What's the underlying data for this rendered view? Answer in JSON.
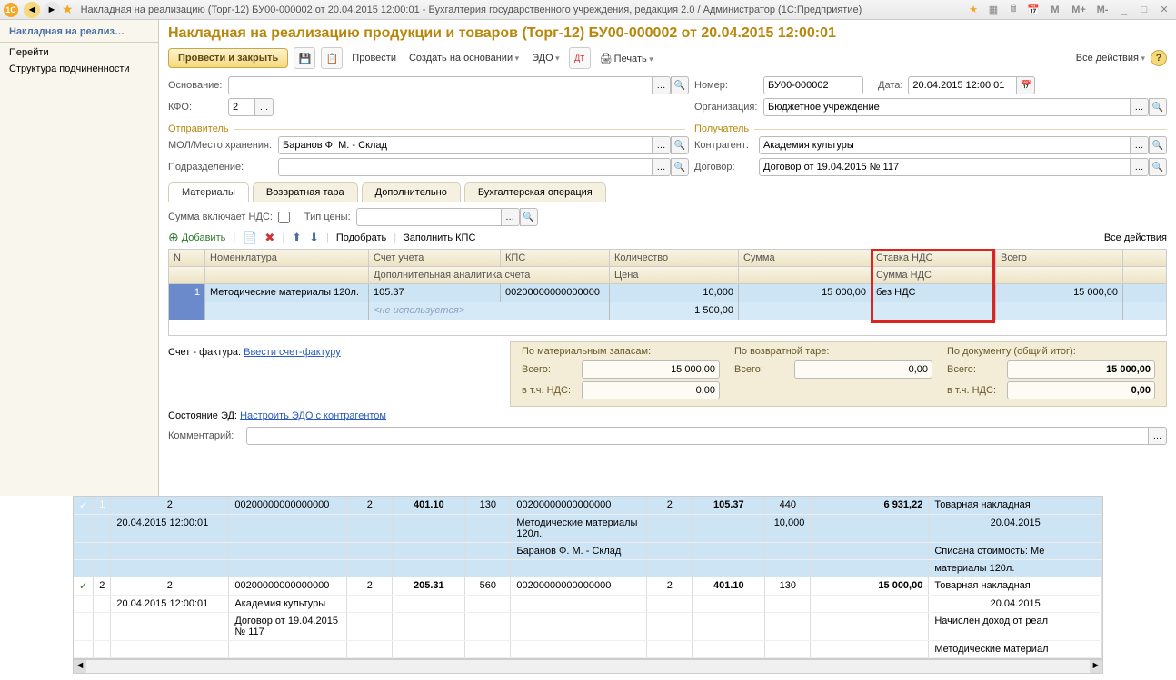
{
  "titlebar": {
    "text": "Накладная на реализацию (Торг-12) БУ00-000002 от 20.04.2015 12:00:01 - Бухгалтерия государственного учреждения, редакция 2.0 / Администратор  (1С:Предприятие)",
    "m": "M",
    "m_plus": "M+",
    "m_minus": "M-"
  },
  "sidebar": {
    "items": [
      "Накладная на реализ…",
      "Перейти",
      "Структура подчиненности"
    ]
  },
  "doc_title": "Накладная на реализацию продукции и товаров (Торг-12) БУ00-000002 от 20.04.2015 12:00:01",
  "toolbar": {
    "post_close": "Провести и закрыть",
    "post": "Провести",
    "create_on": "Создать на основании",
    "edo": "ЭДО",
    "print": "Печать",
    "all_actions": "Все действия"
  },
  "form": {
    "osnovanie_label": "Основание:",
    "osnovanie_value": "",
    "nomer_label": "Номер:",
    "nomer_value": "БУ00-000002",
    "data_label": "Дата:",
    "data_value": "20.04.2015 12:00:01",
    "kfo_label": "КФО:",
    "kfo_value": "2",
    "org_label": "Организация:",
    "org_value": "Бюджетное учреждение",
    "sender_label": "Отправитель",
    "receiver_label": "Получатель",
    "mol_label": "МОЛ/Место хранения:",
    "mol_value": "Баранов Ф. М. - Склад",
    "kontr_label": "Контрагент:",
    "kontr_value": "Академия культуры",
    "podr_label": "Подразделение:",
    "podr_value": "",
    "dogovor_label": "Договор:",
    "dogovor_value": "Договор от 19.04.2015 № 117"
  },
  "tabs": [
    "Материалы",
    "Возвратная тара",
    "Дополнительно",
    "Бухгалтерская операция"
  ],
  "tab_opts": {
    "sum_incl_vat": "Сумма включает НДС:",
    "price_type": "Тип цены:"
  },
  "sub_toolbar": {
    "add": "Добавить",
    "pick": "Подобрать",
    "fill_kps": "Заполнить КПС",
    "all_actions": "Все действия"
  },
  "grid": {
    "headers": {
      "n": "N",
      "nom": "Номенклатура",
      "acc": "Счет учета",
      "kps": "КПС",
      "qty": "Количество",
      "sum": "Сумма",
      "vat_rate": "Ставка НДС",
      "total": "Всего",
      "acc2": "Дополнительная аналитика счета",
      "price": "Цена",
      "vat_sum": "Сумма НДС"
    },
    "row": {
      "n": "1",
      "nom": "Методические материалы 120л.",
      "acc": "105.37",
      "kps": "00200000000000000",
      "qty": "10,000",
      "sum": "15 000,00",
      "vat": "без НДС",
      "total": "15 000,00",
      "acc2": "<не используется>",
      "price": "1 500,00"
    }
  },
  "invoice": {
    "label": "Счет - фактура:",
    "link": "Ввести счет-фактуру"
  },
  "totals": {
    "col1_title": "По материальным запасам:",
    "col2_title": "По возвратной таре:",
    "col3_title": "По документу (общий итог):",
    "vsego": "Всего:",
    "vtch_nds": "в т.ч. НДС:",
    "v1": "15 000,00",
    "n1": "0,00",
    "v2": "0,00",
    "v3": "15 000,00",
    "n3": "0,00"
  },
  "ed_state": {
    "label": "Состояние ЭД:",
    "link": "Настроить ЭДО с контрагентом"
  },
  "comment": {
    "label": "Комментарий:"
  },
  "bg_grid": {
    "r1": {
      "check": "✓",
      "n": "1",
      "c2": "2",
      "kps1": "00200000000000000",
      "c4": "2",
      "acc1": "401.10",
      "c6": "130",
      "kps2": "00200000000000000",
      "c8": "2",
      "acc2": "105.37",
      "c10": "440",
      "sum": "6 931,22",
      "doc": "Товарная накладная",
      "date": "20.04.2015 12:00:01",
      "nom": "Методические материалы 120л.",
      "qty": "10,000",
      "docdate": "20.04.2015",
      "mol": "Баранов Ф. М. - Склад",
      "desc": "Списана стоимость: Ме",
      "desc2": "материалы 120л."
    },
    "r2": {
      "check": "✓",
      "n": "2",
      "c2": "2",
      "kps1": "00200000000000000",
      "c4": "2",
      "acc1": "205.31",
      "c6": "560",
      "kps2": "00200000000000000",
      "c8": "2",
      "acc2": "401.10",
      "c10": "130",
      "sum": "15 000,00",
      "doc": "Товарная накладная",
      "date": "20.04.2015 12:00:01",
      "org": "Академия культуры",
      "docdate": "20.04.2015",
      "dog": "Договор от 19.04.2015 № 117",
      "desc": "Начислен доход от реал",
      "desc2": "Методические материал"
    }
  }
}
